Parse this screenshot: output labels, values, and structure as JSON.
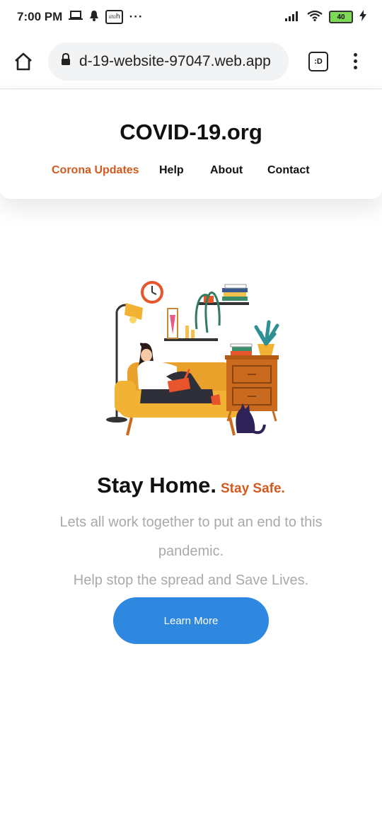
{
  "status_bar": {
    "time": "7:00 PM",
    "more": "···",
    "app_badge": "ஸh",
    "battery": "40",
    "icons": [
      "laptop-icon",
      "bell-icon",
      "app-badge-icon",
      "signal-icon",
      "wifi-icon",
      "battery-icon",
      "charging-icon"
    ]
  },
  "browser": {
    "url": "d-19-website-97047.web.app",
    "tab_label": ":D",
    "icons": [
      "home-icon",
      "lock-icon",
      "tab-switcher-icon",
      "more-vert-icon"
    ]
  },
  "site": {
    "title": "COVID-19.org",
    "nav": [
      {
        "label": "Corona Updates",
        "active": true
      },
      {
        "label": "Help",
        "active": false
      },
      {
        "label": "About",
        "active": false
      },
      {
        "label": "Contact",
        "active": false
      }
    ]
  },
  "hero": {
    "heading_main": "Stay Home.",
    "heading_accent": "Stay Safe.",
    "line1": "Lets all work together to put an end to this pandemic.",
    "line2": "Help stop the spread and Save Lives.",
    "button_label": "Learn More"
  },
  "colors": {
    "accent": "#d35a1e",
    "button": "#2e88e0",
    "muted_text": "#a9a9a9"
  }
}
